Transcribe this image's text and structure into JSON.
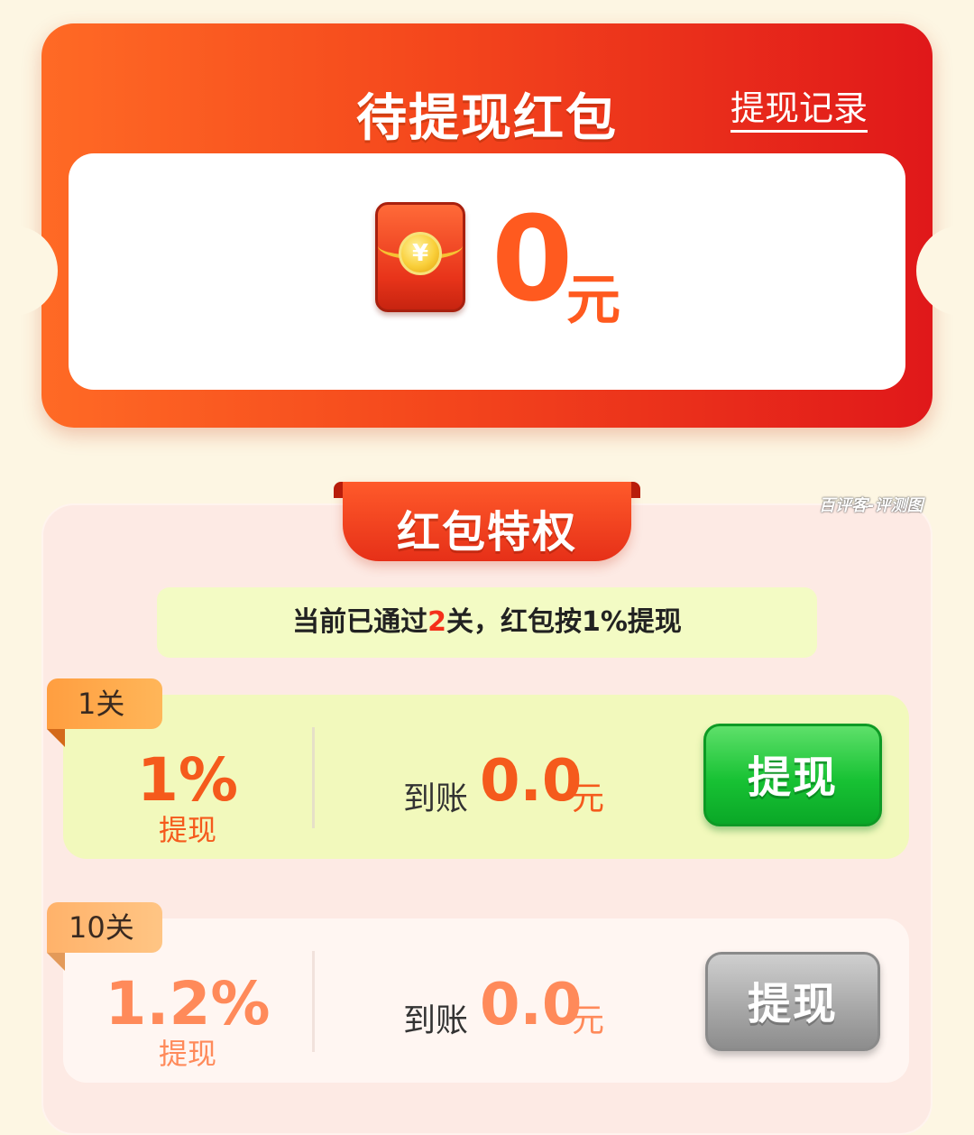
{
  "header": {
    "title": "待提现红包",
    "record_link": "提现记录"
  },
  "balance": {
    "amount": "0",
    "unit": "元",
    "coin_symbol": "¥"
  },
  "privilege": {
    "ribbon_title": "红包特权",
    "watermark": "百评客-评测图",
    "status": {
      "prefix": "当前已通过",
      "level_count": "2",
      "suffix": "关，红包按1%提现"
    },
    "levels": [
      {
        "tab": "1关",
        "percent": "1%",
        "percent_label": "提现",
        "arrive_label": "到账",
        "arrive_value": "0.0",
        "arrive_unit": "元",
        "button": "提现",
        "state": "active"
      },
      {
        "tab": "10关",
        "percent": "1.2%",
        "percent_label": "提现",
        "arrive_label": "到账",
        "arrive_value": "0.0",
        "arrive_unit": "元",
        "button": "提现",
        "state": "disabled"
      }
    ]
  },
  "colors": {
    "brand_red": "#e63018",
    "orange": "#f55a1c",
    "active_green": "#18c234",
    "disabled_gray": "#a6a6a6"
  }
}
